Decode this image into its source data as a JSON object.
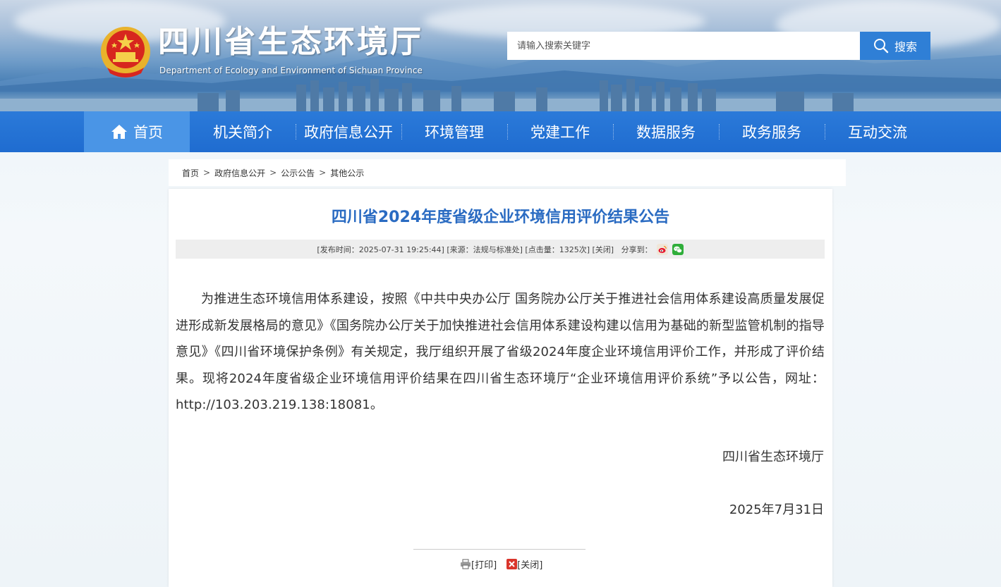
{
  "header": {
    "title": "四川省生态环境厅",
    "subtitle": "Department of Ecology and Environment of Sichuan Province",
    "search": {
      "placeholder": "请输入搜索关键字",
      "button_label": "搜索"
    }
  },
  "nav": {
    "items": [
      {
        "label": "首页",
        "icon": "home-icon",
        "active": true
      },
      {
        "label": "机关简介"
      },
      {
        "label": "政府信息公开"
      },
      {
        "label": "环境管理"
      },
      {
        "label": "党建工作"
      },
      {
        "label": "数据服务"
      },
      {
        "label": "政务服务"
      },
      {
        "label": "互动交流"
      }
    ]
  },
  "breadcrumb": {
    "items": [
      "首页",
      "政府信息公开",
      "公示公告",
      "其他公示"
    ],
    "separator": ">"
  },
  "article": {
    "title": "四川省2024年度省级企业环境信用评价结果公告",
    "meta": {
      "publish": "[发布时间：2025-07-31 19:25:44]",
      "source": " [来源：法规与标准处]",
      "clicks": " [点击量：1325次]",
      "close": " [关闭]",
      "share": "   分享到："
    },
    "share_icons": [
      "weibo-icon",
      "wechat-icon"
    ],
    "body": "为推进生态环境信用体系建设，按照《中共中央办公厅 国务院办公厅关于推进社会信用体系建设高质量发展促进形成新发展格局的意见》《国务院办公厅关于加快推进社会信用体系建设构建以信用为基础的新型监管机制的指导意见》《四川省环境保护条例》有关规定，我厅组织开展了省级2024年度企业环境信用评价工作，并形成了评价结果。现将2024年度省级企业环境信用评价结果在四川省生态环境厅“企业环境信用评价系统”予以公告，网址：http://103.203.219.138:18081。",
    "signature": "四川省生态环境厅",
    "date": "2025年7月31日"
  },
  "footer_actions": {
    "print": "[打印]",
    "close": "[关闭]"
  },
  "colors": {
    "nav_bg": "#1f6cd0",
    "nav_active": "#4a95e6",
    "title": "#2a6bc2",
    "search_btn": "#2f7fd6"
  }
}
